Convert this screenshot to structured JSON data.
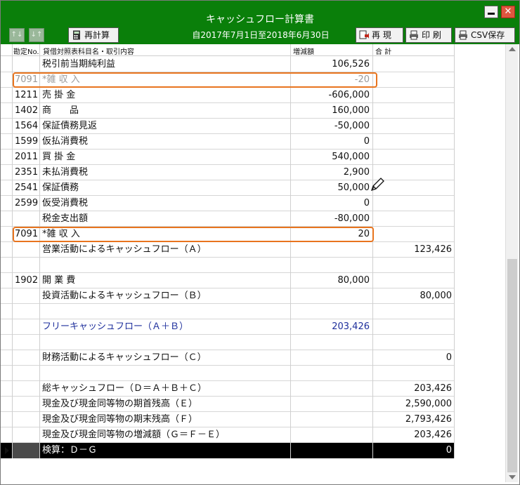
{
  "window": {
    "title": "キャッシュフロー計算書"
  },
  "toolbar": {
    "recalc_label": "再計算",
    "period_text": "自2017年7月1日至2018年6月30日",
    "redisplay_label": "再 現",
    "print_label": "印 刷",
    "csv_label": "CSV保存"
  },
  "columns": {
    "code": "勘定No.",
    "name": "貸借対照表科目名・取引内容",
    "amount": "増減額",
    "total": "合 計"
  },
  "rows": [
    {
      "code": "",
      "name": "税引前当期純利益",
      "amount": "106,526",
      "total": ""
    },
    {
      "code": "7091",
      "name": "*雑 収 入",
      "amount": "-20",
      "total": ""
    },
    {
      "code": "1211",
      "name": "売 掛 金",
      "amount": "-606,000",
      "total": ""
    },
    {
      "code": "1402",
      "name": "商　　品",
      "amount": "160,000",
      "total": ""
    },
    {
      "code": "1564",
      "name": "保証債務見返",
      "amount": "-50,000",
      "total": ""
    },
    {
      "code": "1599",
      "name": "仮払消費税",
      "amount": "0",
      "total": ""
    },
    {
      "code": "2011",
      "name": "買 掛 金",
      "amount": "540,000",
      "total": ""
    },
    {
      "code": "2351",
      "name": "未払消費税",
      "amount": "2,900",
      "total": ""
    },
    {
      "code": "2541",
      "name": "保証債務",
      "amount": "50,000",
      "total": ""
    },
    {
      "code": "2599",
      "name": "仮受消費税",
      "amount": "0",
      "total": ""
    },
    {
      "code": "",
      "name": "税金支出額",
      "amount": "-80,000",
      "total": ""
    },
    {
      "code": "7091",
      "name": "*雑 収 入",
      "amount": "20",
      "total": ""
    },
    {
      "code": "",
      "name": "営業活動によるキャッシュフロー（Ａ）",
      "amount": "",
      "total": "123,426"
    },
    {
      "code": "",
      "name": "",
      "amount": "",
      "total": ""
    },
    {
      "code": "1902",
      "name": "開 業 費",
      "amount": "80,000",
      "total": ""
    },
    {
      "code": "",
      "name": "投資活動によるキャッシュフロー（Ｂ）",
      "amount": "",
      "total": "80,000"
    },
    {
      "code": "",
      "name": "",
      "amount": "",
      "total": ""
    },
    {
      "code": "",
      "name": "フリーキャッシュフロー（Ａ＋Ｂ）",
      "amount": "203,426",
      "total": ""
    },
    {
      "code": "",
      "name": "",
      "amount": "",
      "total": ""
    },
    {
      "code": "",
      "name": "財務活動によるキャッシュフロー（Ｃ）",
      "amount": "",
      "total": "0"
    },
    {
      "code": "",
      "name": "",
      "amount": "",
      "total": ""
    },
    {
      "code": "",
      "name": "総キャッシュフロー（Ｄ＝Ａ＋Ｂ＋Ｃ）",
      "amount": "",
      "total": "203,426"
    },
    {
      "code": "",
      "name": "現金及び現金同等物の期首残高（Ｅ）",
      "amount": "",
      "total": "2,590,000"
    },
    {
      "code": "",
      "name": "現金及び現金同等物の期末残高（Ｆ）",
      "amount": "",
      "total": "2,793,426"
    },
    {
      "code": "",
      "name": "現金及び現金同等物の増減額（Ｇ＝Ｆ－Ｅ）",
      "amount": "",
      "total": "203,426"
    },
    {
      "code": "",
      "name": "検算：Ｄ－Ｇ",
      "amount": "",
      "total": "0"
    }
  ]
}
